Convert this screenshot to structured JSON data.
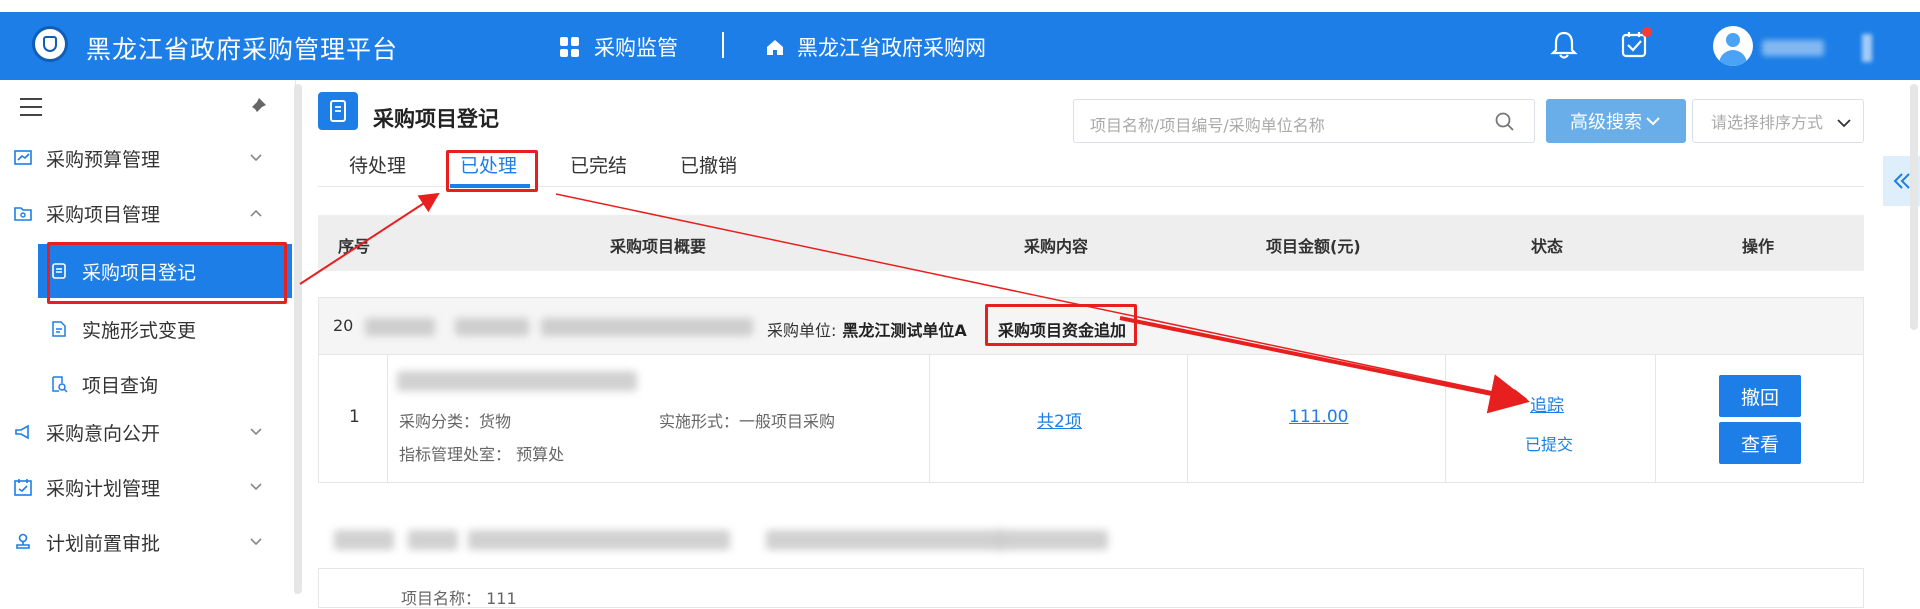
{
  "header": {
    "app_title": "黑龙江省政府采购管理平台",
    "nav_supervision": "采购监管",
    "nav_site": "黑龙江省政府采购网"
  },
  "sidebar": {
    "items": [
      {
        "label": "采购预算管理"
      },
      {
        "label": "采购项目管理"
      },
      {
        "label": "采购项目登记"
      },
      {
        "label": "实施形式变更"
      },
      {
        "label": "项目查询"
      },
      {
        "label": "采购意向公开"
      },
      {
        "label": "采购计划管理"
      },
      {
        "label": "计划前置审批"
      }
    ]
  },
  "page": {
    "title": "采购项目登记",
    "search_placeholder": "项目名称/项目编号/采购单位名称",
    "advanced_search": "高级搜索",
    "sort_placeholder": "请选择排序方式"
  },
  "tabs": [
    "待处理",
    "已处理",
    "已完结",
    "已撤销"
  ],
  "table": {
    "headers": [
      "序号",
      "采购项目概要",
      "采购内容",
      "项目金额(元)",
      "状态",
      "操作"
    ],
    "group": {
      "no_prefix": "20",
      "unit_label": "采购单位:",
      "unit_name": "黑龙江测试单位A",
      "tag": "采购项目资金追加"
    },
    "row": {
      "no": "1",
      "category": "采购分类：货物",
      "form": "实施形式：一般项目采购",
      "dept": "指标管理处室：  预算处",
      "content_link": "共2项",
      "amount": "111.00",
      "track_link": "追踪",
      "status": "已提交",
      "btn_revoke": "撤回",
      "btn_view": "查看"
    },
    "row2": {
      "partial_line": "项目名称：  111"
    }
  },
  "colors": {
    "primary": "#1c7ee6",
    "annotation_red": "#e81f1f",
    "adv_button": "#69aee8"
  }
}
